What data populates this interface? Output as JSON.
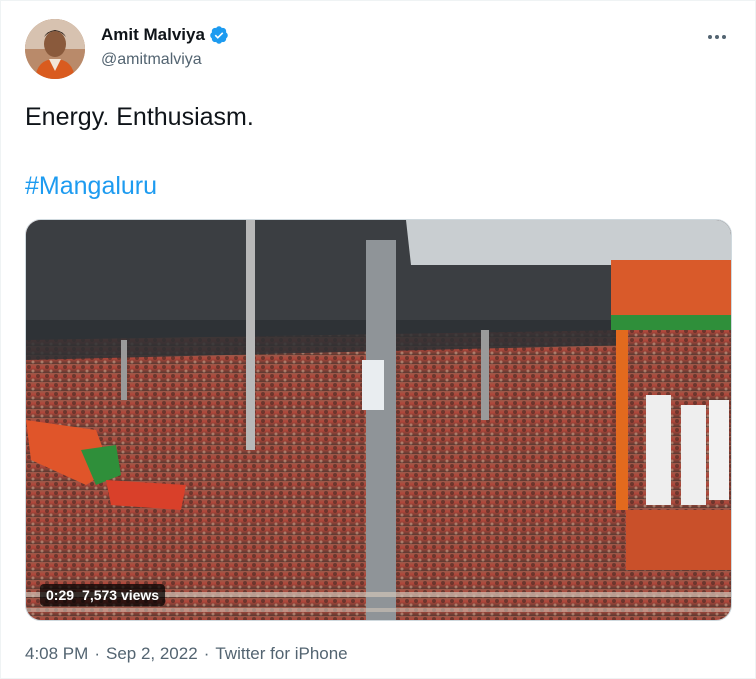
{
  "author": {
    "name": "Amit Malviya",
    "handle": "@amitmalviya",
    "verified_icon": "verified-badge-icon",
    "verified_color": "#1d9bf0"
  },
  "tweet": {
    "text": "Energy. Enthusiasm.",
    "hashtag": "#Mangaluru"
  },
  "media": {
    "type": "video",
    "duration": "0:29",
    "views": "7,573 views"
  },
  "meta": {
    "time": "4:08 PM",
    "separator1": "·",
    "date": "Sep 2, 2022",
    "separator2": "·",
    "source": "Twitter for iPhone"
  },
  "colors": {
    "link": "#1d9bf0",
    "secondary_text": "#536471",
    "primary_text": "#0f1419"
  }
}
